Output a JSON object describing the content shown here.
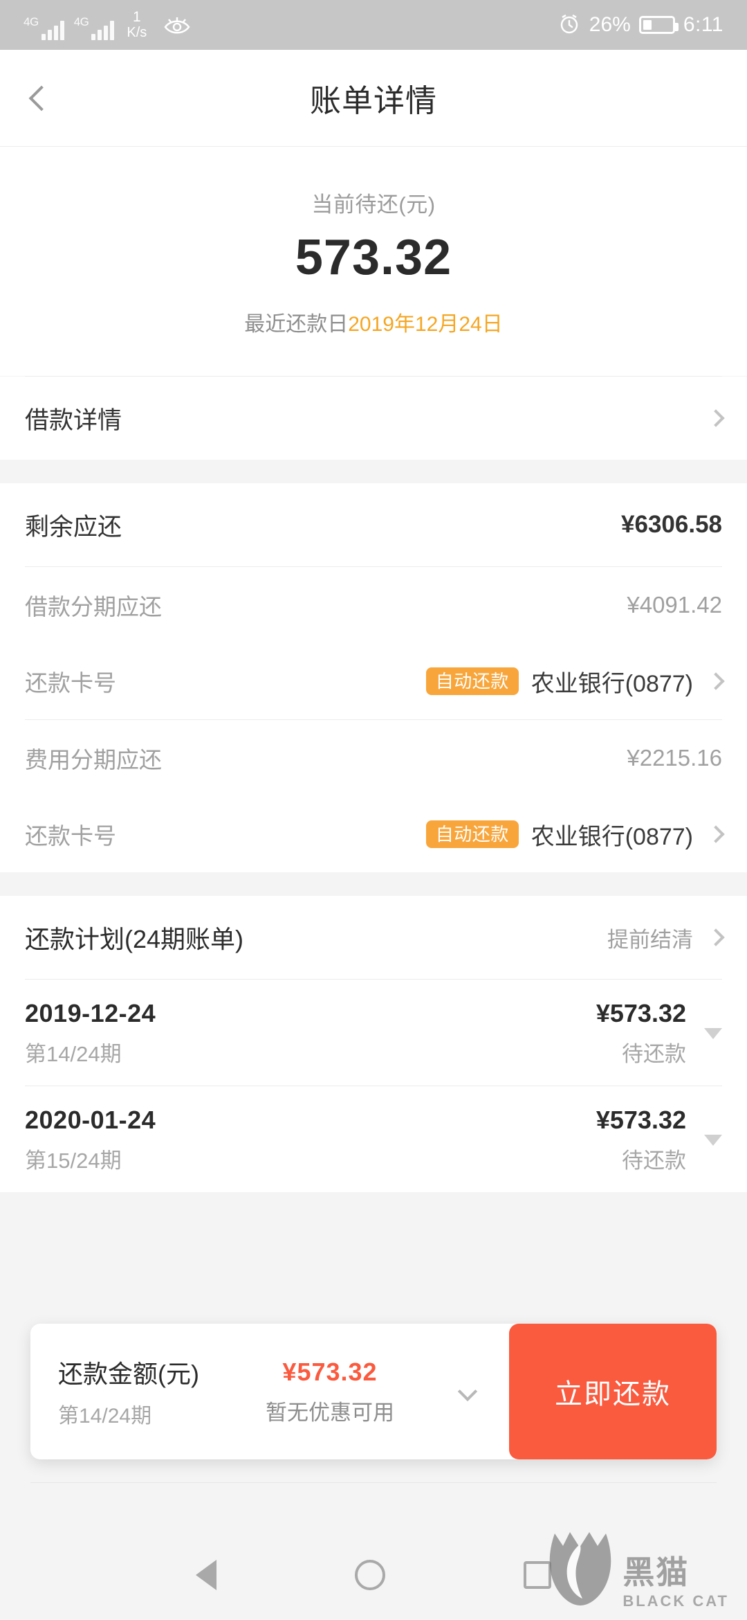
{
  "statusbar": {
    "network_badge_1": "4G",
    "network_badge_2": "4G",
    "speed_value": "1",
    "speed_unit": "K/s",
    "eye_icon": "eye-comfort-icon",
    "alarm_icon": "alarm-clock-icon",
    "battery_percent": "26%",
    "battery_icon": "battery-icon",
    "clock": "6:11"
  },
  "appbar": {
    "back_icon": "chevron-left-icon",
    "title": "账单详情"
  },
  "summary": {
    "label": "当前待还(元)",
    "amount": "573.32",
    "due_prefix": "最近还款日",
    "due_date": "2019年12月24日",
    "due_date_color": "#f5a623"
  },
  "loan_detail_row": {
    "label": "借款详情",
    "chevron_icon": "chevron-right-icon"
  },
  "balance_section": {
    "remaining": {
      "label": "剩余应还",
      "value": "¥6306.58"
    },
    "principal": {
      "label": "借款分期应还",
      "value": "¥4091.42"
    },
    "principal_card": {
      "label": "还款卡号",
      "badge": "自动还款",
      "bank": "农业银行(0877)",
      "chevron_icon": "chevron-right-icon"
    },
    "fee": {
      "label": "费用分期应还",
      "value": "¥2215.16"
    },
    "fee_card": {
      "label": "还款卡号",
      "badge": "自动还款",
      "bank": "农业银行(0877)",
      "chevron_icon": "chevron-right-icon"
    },
    "badge_color": "#f8a63c"
  },
  "plan": {
    "title": "还款计划(24期账单)",
    "settle_label": "提前结清",
    "chevron_icon": "chevron-right-icon",
    "installments": [
      {
        "date": "2019-12-24",
        "term": "第14/24期",
        "amount": "¥573.32",
        "status": "待还款",
        "expand_icon": "triangle-down-icon"
      },
      {
        "date": "2020-01-24",
        "term": "第15/24期",
        "amount": "¥573.32",
        "status": "待还款",
        "expand_icon": "triangle-down-icon"
      }
    ]
  },
  "paybar": {
    "amount_label": "还款金额(元)",
    "term": "第14/24期",
    "amount": "¥573.32",
    "coupon_note": "暂无优惠可用",
    "expand_icon": "chevron-down-icon",
    "button_label": "立即还款",
    "button_color": "#fa5a3e",
    "amount_color": "#fa5a3e"
  },
  "navbar": {
    "back_icon": "android-back-icon",
    "home_icon": "android-home-icon",
    "recents_icon": "android-recents-icon"
  },
  "watermark": {
    "cn": "黑猫",
    "en": "BLACK CAT",
    "logo_icon": "black-cat-logo-icon"
  }
}
